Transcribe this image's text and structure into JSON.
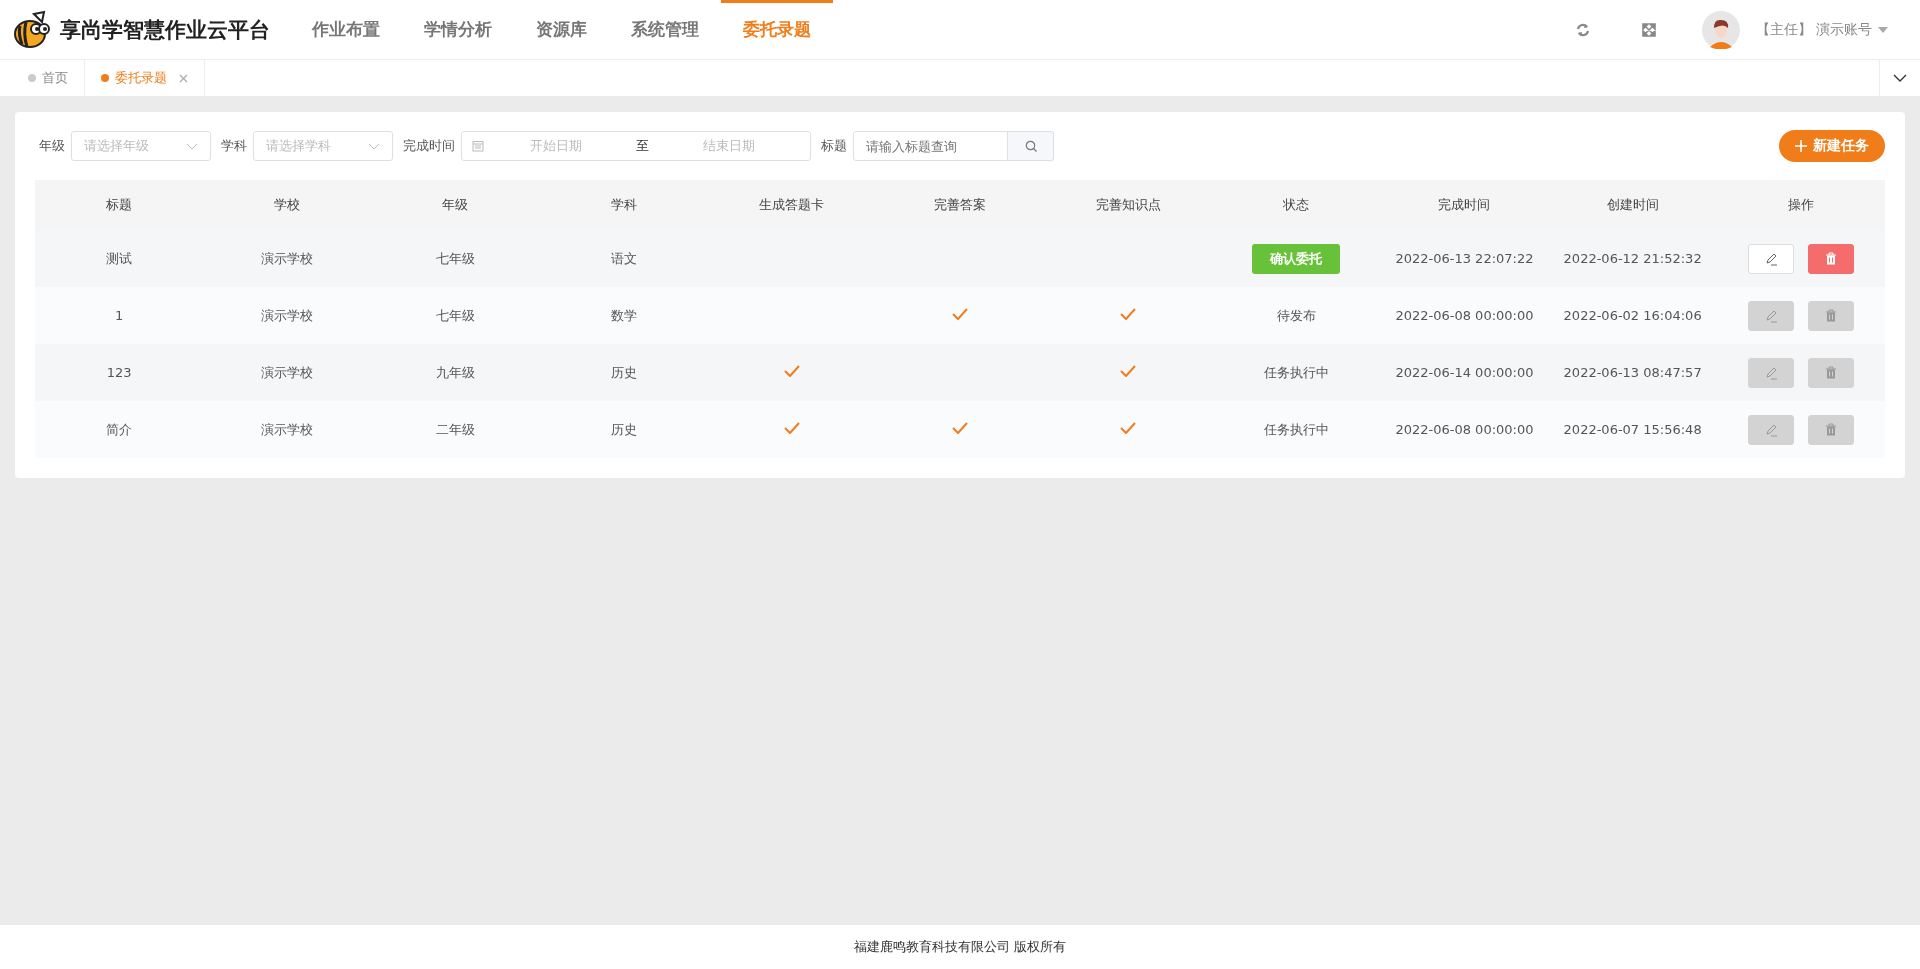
{
  "brand": {
    "title": "享尚学智慧作业云平台"
  },
  "nav": [
    {
      "label": "作业布置",
      "selected": false
    },
    {
      "label": "学情分析",
      "selected": false
    },
    {
      "label": "资源库",
      "selected": false
    },
    {
      "label": "系统管理",
      "selected": false
    },
    {
      "label": "委托录题",
      "selected": true
    }
  ],
  "user": {
    "role": "【主任】",
    "name": "演示账号"
  },
  "tabs": [
    {
      "label": "首页",
      "selected": false,
      "closable": false
    },
    {
      "label": "委托录题",
      "selected": true,
      "closable": true
    }
  ],
  "filters": {
    "grade": {
      "label": "年级",
      "placeholder": "请选择年级"
    },
    "subject": {
      "label": "学科",
      "placeholder": "请选择学科"
    },
    "date": {
      "label": "完成时间",
      "start_placeholder": "开始日期",
      "separator": "至",
      "end_placeholder": "结束日期"
    },
    "title": {
      "label": "标题",
      "placeholder": "请输入标题查询"
    }
  },
  "new_button": {
    "label": "新建任务"
  },
  "table": {
    "columns": [
      "标题",
      "学校",
      "年级",
      "学科",
      "生成答题卡",
      "完善答案",
      "完善知识点",
      "状态",
      "完成时间",
      "创建时间",
      "操作"
    ],
    "rows": [
      {
        "title": "测试",
        "school": "演示学校",
        "grade": "七年级",
        "subject": "语文",
        "answer_card": false,
        "answers": false,
        "knowledge": false,
        "status": {
          "kind": "button",
          "label": "确认委托"
        },
        "finished": "2022-06-13 22:07:22",
        "created": "2022-06-12 21:52:32",
        "actions_disabled": false
      },
      {
        "title": "1",
        "school": "演示学校",
        "grade": "七年级",
        "subject": "数学",
        "answer_card": false,
        "answers": true,
        "knowledge": true,
        "status": {
          "kind": "text",
          "label": "待发布"
        },
        "finished": "2022-06-08 00:00:00",
        "created": "2022-06-02 16:04:06",
        "actions_disabled": true
      },
      {
        "title": "123",
        "school": "演示学校",
        "grade": "九年级",
        "subject": "历史",
        "answer_card": true,
        "answers": false,
        "knowledge": true,
        "status": {
          "kind": "text",
          "label": "任务执行中"
        },
        "finished": "2022-06-14 00:00:00",
        "created": "2022-06-13 08:47:57",
        "actions_disabled": true
      },
      {
        "title": "简介",
        "school": "演示学校",
        "grade": "二年级",
        "subject": "历史",
        "answer_card": true,
        "answers": true,
        "knowledge": true,
        "status": {
          "kind": "text",
          "label": "任务执行中"
        },
        "finished": "2022-06-08 00:00:00",
        "created": "2022-06-07 15:56:48",
        "actions_disabled": true
      }
    ]
  },
  "footer": "福建鹿鸣教育科技有限公司 版权所有"
}
